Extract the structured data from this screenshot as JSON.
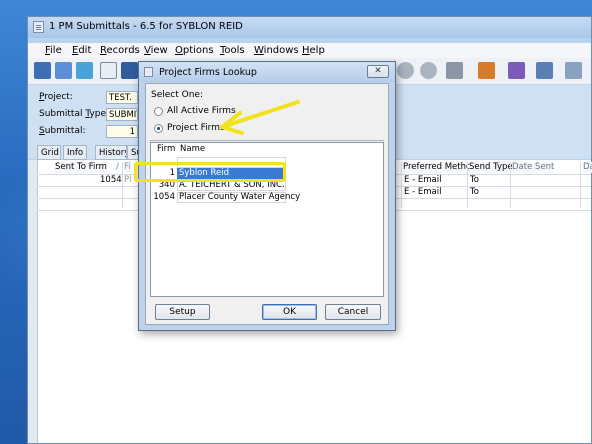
{
  "window": {
    "title": "1 PM Submittals - 6.5 for SYBLON REID"
  },
  "menu": [
    {
      "label": "File",
      "key": "F",
      "rest": "ile"
    },
    {
      "label": "Edit",
      "key": "E",
      "rest": "dit"
    },
    {
      "label": "Records",
      "key": "R",
      "rest": "ecords"
    },
    {
      "label": "View",
      "key": "V",
      "rest": "iew"
    },
    {
      "label": "Options",
      "key": "O",
      "rest": "ptions"
    },
    {
      "label": "Tools",
      "key": "T",
      "rest": "ools"
    },
    {
      "label": "Windows",
      "key": "W",
      "rest": "indows"
    },
    {
      "label": "Help",
      "key": "H",
      "rest": "elp"
    }
  ],
  "form": {
    "project_label_key": "P",
    "project_label_rest": "roject:",
    "project_value": "TEST.",
    "type_label_pre": "Submittal ",
    "type_label_key": "T",
    "type_label_rest": "ype:",
    "type_value": "SUBMIT",
    "submittal_label_key": "S",
    "submittal_label_rest": "ubmittal:",
    "submittal_value": "1"
  },
  "tabs": [
    "Grid",
    "Info",
    "History",
    "Su"
  ],
  "grid": {
    "headers": {
      "sent_to_firm": "Sent To Firm",
      "sort": "/",
      "fi": "Fi",
      "preferred": "Preferred Method",
      "send_type": "Send Type",
      "date_sent": "Date Sent",
      "da": "Da"
    },
    "rows": [
      {
        "firm": "1054",
        "fi": "Pl",
        "method": "E - Email",
        "send_type": "To"
      },
      {
        "firm": "",
        "fi": "",
        "method": "E - Email",
        "send_type": "To"
      }
    ]
  },
  "dialog": {
    "title": "Project Firms Lookup",
    "select_label": "Select One:",
    "options": [
      {
        "label": "All Active Firms",
        "selected": false
      },
      {
        "label": "Project Firms",
        "selected": true
      }
    ],
    "columns": {
      "firm": "Firm",
      "name": "Name"
    },
    "rows": [
      {
        "firm": "1",
        "name": "Syblon Reid",
        "selected": true
      },
      {
        "firm": "340",
        "name": "A. TEICHERT & SON, INC.",
        "selected": false
      },
      {
        "firm": "1054",
        "name": "Placer County Water Agency",
        "selected": false
      }
    ],
    "buttons": {
      "setup": "Setup",
      "ok": "OK",
      "cancel": "Cancel"
    }
  },
  "colors": {
    "highlight": "#f2e21b",
    "selection": "#3b7ad2"
  },
  "icons": [
    "app-icon",
    "close-icon",
    "pencil-icon",
    "save-icon",
    "arrow-icon"
  ]
}
